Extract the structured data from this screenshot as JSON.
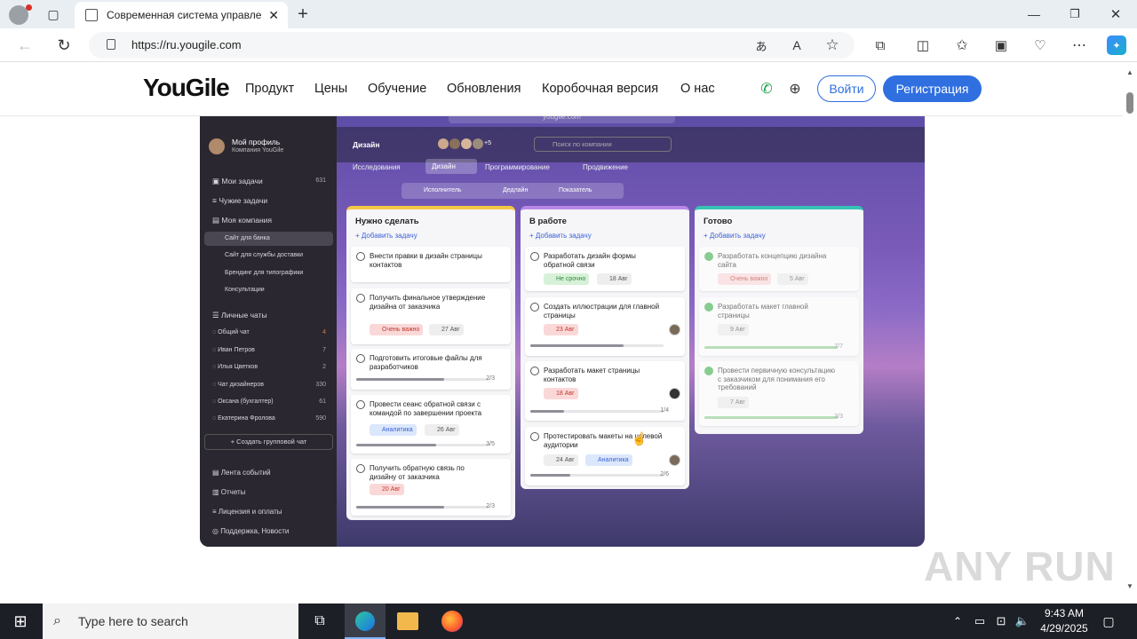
{
  "browser": {
    "tab_title": "Современная система управле",
    "url": "https://ru.yougile.com"
  },
  "site": {
    "logo": "YouGile",
    "nav": [
      "Продукт",
      "Цены",
      "Обучение",
      "Обновления",
      "Коробочная версия",
      "О нас"
    ],
    "login": "Войти",
    "register": "Регистрация"
  },
  "mock": {
    "address": "yougile.com",
    "profile": "Мой профиль",
    "company": "Компания YouGile",
    "project": "Дизайн",
    "presence": "+5",
    "search_placeholder": "Поиск по компании",
    "tabs": [
      "Исследования",
      "Дизайн",
      "Программирование",
      "Продвижение"
    ],
    "filters": [
      "Исполнитель",
      "Дедлайн",
      "Показатель"
    ],
    "sidebar": {
      "items": [
        {
          "label": "Мои задачи",
          "count": "631"
        },
        {
          "label": "Чужие задачи",
          "count": ""
        },
        {
          "label": "Моя компания",
          "count": ""
        }
      ],
      "projects": [
        "Сайт для банка",
        "Сайт для службы доставки",
        "Брендинг для типографики",
        "Консультации"
      ],
      "chats_title": "Личные чаты",
      "chats": [
        {
          "label": "Общий чат",
          "count": "4"
        },
        {
          "label": "Иван Петров",
          "count": "7"
        },
        {
          "label": "Илья Цветков",
          "count": "2"
        },
        {
          "label": "Чат дизайнеров",
          "count": "330"
        },
        {
          "label": "Оксана (бухгалтер)",
          "count": "61"
        },
        {
          "label": "Екатерина Фролова",
          "count": "590"
        }
      ],
      "group_chat": "+ Создать групповой чат",
      "bottom": [
        "Лента событий",
        "Отчеты",
        "Лицензия и оплаты",
        "Поддержка, Новости"
      ]
    },
    "columns": [
      {
        "title": "Нужно сделать",
        "add": "+ Добавить задачу",
        "cards": [
          {
            "title": "Внести правки в дизайн страницы контактов"
          },
          {
            "title": "Получить финальное утверждение дизайна от заказчика",
            "chips": [
              "Очень важно",
              "27 Авг"
            ]
          },
          {
            "title": "Подготовить итоговые файлы для разработчиков",
            "count": "2/3",
            "progress": 0.66
          },
          {
            "title": "Провести сеанс обратной связи с командой по завершении проекта",
            "chips": [
              "Аналитика",
              "26 Авг"
            ],
            "count": "3/5",
            "progress": 0.6
          },
          {
            "title": "Получить обратную связь по дизайну от заказчика",
            "chips": [
              "20 Авг"
            ],
            "count": "2/3",
            "progress": 0.66
          }
        ]
      },
      {
        "title": "В работе",
        "add": "+ Добавить задачу",
        "cards": [
          {
            "title": "Разработать дизайн формы обратной связи",
            "chips": [
              "Не срочно",
              "18 Авг"
            ]
          },
          {
            "title": "Создать иллюстрации для главной страницы",
            "chips": [
              "23 Авг"
            ],
            "count": "",
            "progress": 0.7
          },
          {
            "title": "Разработать макет страницы контактов",
            "chips": [
              "18 Авг"
            ],
            "count": "1/4",
            "progress": 0.25
          },
          {
            "title": "Протестировать макеты на целевой аудитории",
            "chips": [
              "24 Авг",
              "Аналитика"
            ],
            "count": "2/6",
            "progress": 0.3
          }
        ]
      },
      {
        "title": "Готово",
        "add": "+ Добавить задачу",
        "cards": [
          {
            "title": "Разработать концепцию дизайна сайта",
            "chips": [
              "Очень важно",
              "5 Авг"
            ]
          },
          {
            "title": "Разработать макет главной страницы",
            "chips": [
              "9 Авг"
            ],
            "count": "7/7",
            "progress": 1
          },
          {
            "title": "Провести первичную консультацию с заказчиком для понимания его требований",
            "chips": [
              "7 Авг"
            ],
            "count": "3/3",
            "progress": 1
          }
        ]
      }
    ]
  },
  "watermark": "ANY RUN",
  "taskbar": {
    "search_placeholder": "Type here to search",
    "time": "9:43 AM",
    "date": "4/29/2025"
  }
}
